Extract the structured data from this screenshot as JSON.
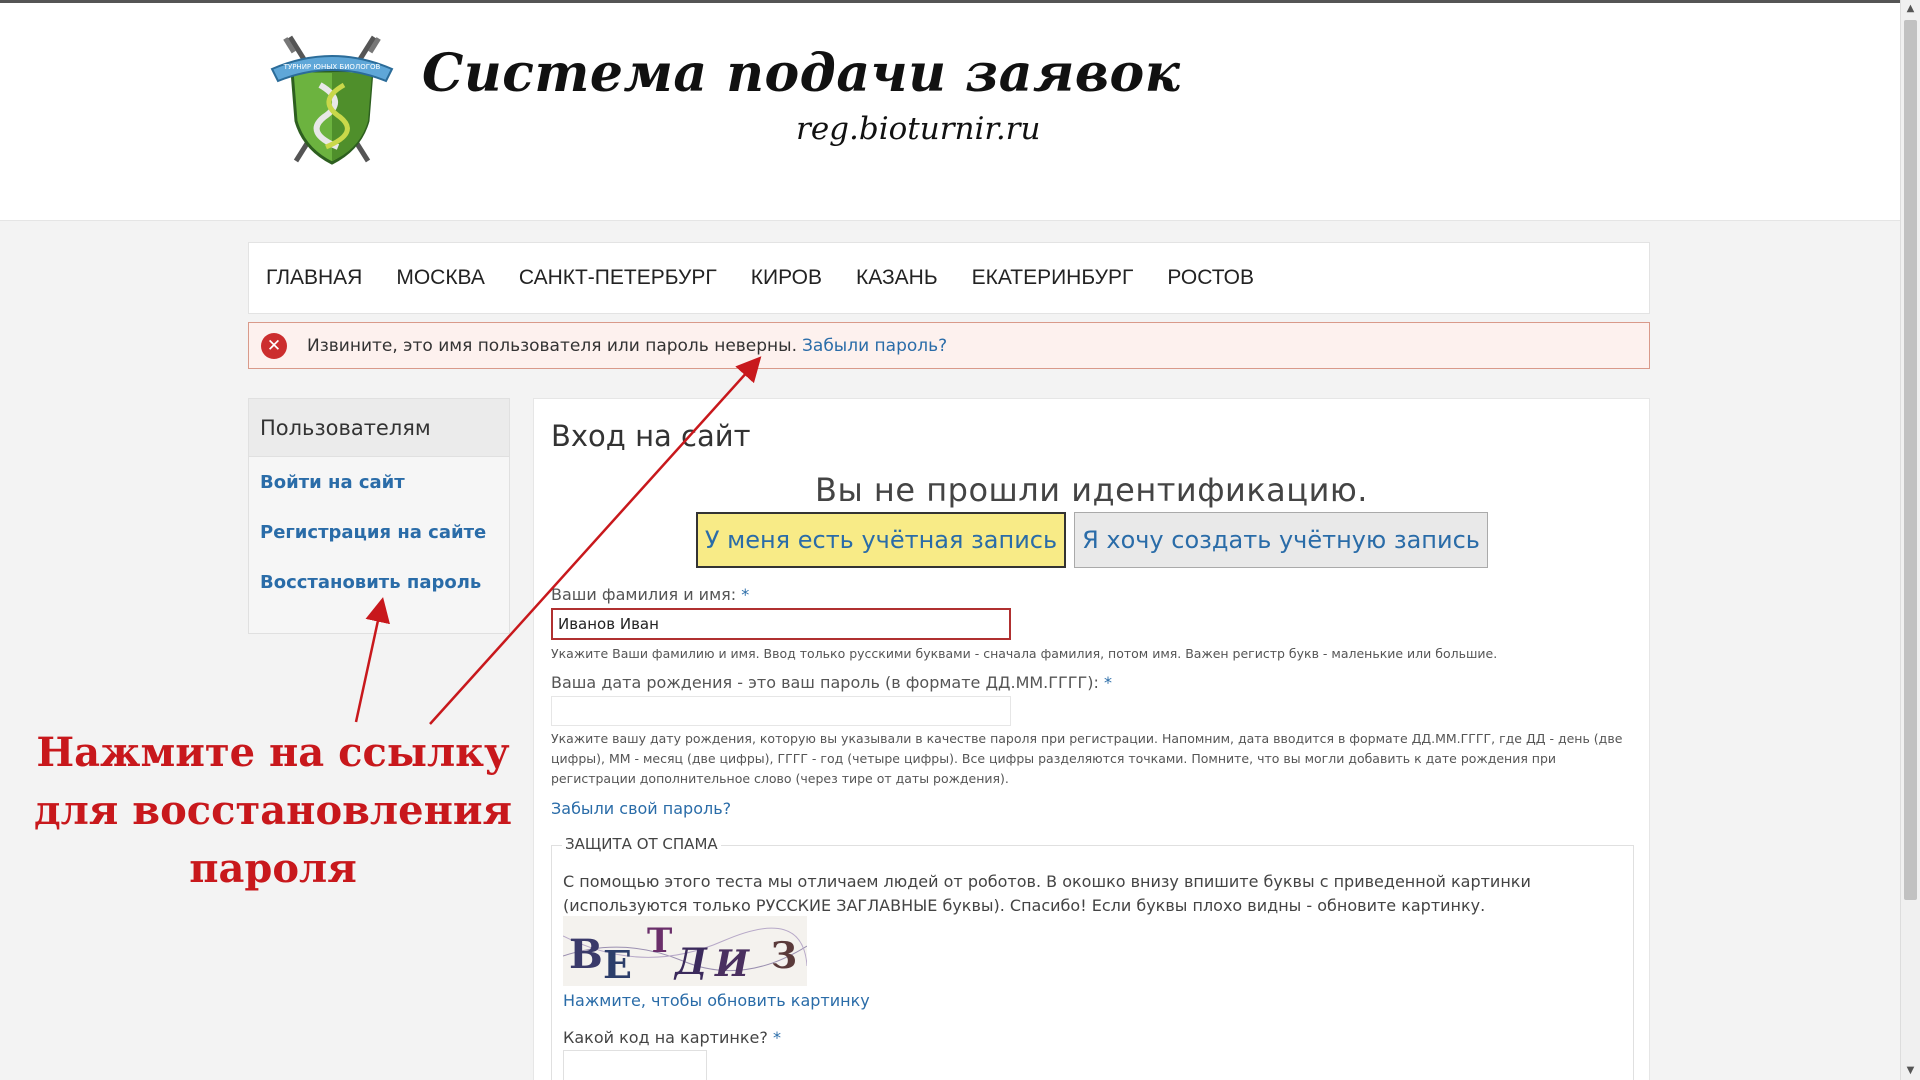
{
  "header": {
    "title": "Система подачи заявок",
    "subtitle": "reg.bioturnir.ru",
    "logo_text": "ТУРНИР ЮНЫХ БИОЛОГОВ"
  },
  "nav": {
    "items": [
      "ГЛАВНАЯ",
      "МОСКВА",
      "САНКТ-ПЕТЕРБУРГ",
      "КИРОВ",
      "КАЗАНЬ",
      "ЕКАТЕРИНБУРГ",
      "РОСТОВ"
    ]
  },
  "alert": {
    "message": "Извините, это имя пользователя или пароль неверны.",
    "link": "Забыли пароль?"
  },
  "sidebar": {
    "title": "Пользователям",
    "links": [
      "Войти на сайт",
      "Регистрация на сайте",
      "Восстановить пароль"
    ]
  },
  "main": {
    "title": "Вход на сайт",
    "not_authenticated": "Вы не прошли идентификацию.",
    "btn_have_account": "У меня есть учётная запись",
    "btn_create_account": "Я хочу создать учётную запись",
    "name_label": "Ваши фамилия и имя:",
    "required_mark": "*",
    "name_value": "Иванов Иван",
    "name_hint": "Укажите Ваши фамилию и имя. Ввод только русскими буквами - сначала фамилия, потом имя. Важен регистр букв - маленькие или большие.",
    "date_label": "Ваша дата рождения - это ваш пароль (в формате ДД.ММ.ГГГГ):",
    "date_value": "",
    "date_hint": "Укажите вашу дату рождения, которую вы указывали в качестве пароля при регистрации. Напомним, дата вводится в формате ДД.ММ.ГГГГ, где ДД - день (две цифры), ММ - месяц (две цифры), ГГГГ - год (четыре цифры). Все цифры разделяются точками. Помните, что вы могли добавить к дате рождения при регистрации дополнительное слово (через тире от даты рождения).",
    "forgot_own": "Забыли свой пароль?"
  },
  "spam": {
    "legend": "ЗАЩИТА ОТ СПАМА",
    "text": "С помощью этого теста мы отличаем людей от роботов. В окошко внизу впишите буквы с приведенной картинки (используются только РУССКИЕ ЗАГЛАВНЫЕ буквы). Спасибо! Если буквы плохо видны - обновите картинку.",
    "captcha_letters": [
      "В",
      "Е",
      "Т",
      "Д",
      "И",
      "З"
    ],
    "refresh_link": "Нажмите, чтобы обновить картинку",
    "code_label": "Какой код на картинке?",
    "code_value": ""
  },
  "annotation": {
    "text": "Нажмите на ссылку для восстановления пароля",
    "color": "#c8181c"
  },
  "colors": {
    "link": "#2a6ca8",
    "active_button": "#f8eb87",
    "error": "#cc2e2e"
  }
}
